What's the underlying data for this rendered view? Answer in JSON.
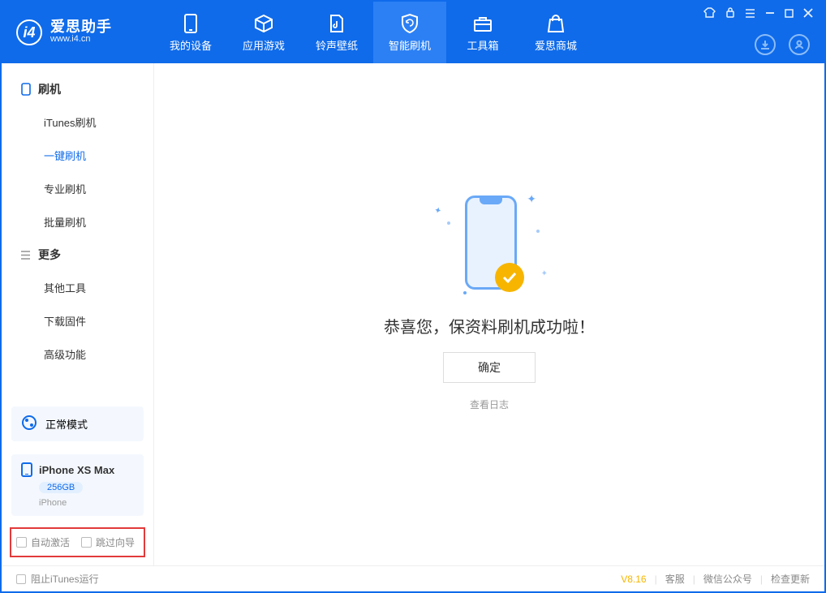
{
  "app": {
    "name": "爱思助手",
    "domain": "www.i4.cn"
  },
  "nav": {
    "tabs": [
      {
        "label": "我的设备"
      },
      {
        "label": "应用游戏"
      },
      {
        "label": "铃声壁纸"
      },
      {
        "label": "智能刷机"
      },
      {
        "label": "工具箱"
      },
      {
        "label": "爱思商城"
      }
    ],
    "active_index": 3
  },
  "sidebar": {
    "groups": [
      {
        "title": "刷机",
        "items": [
          "iTunes刷机",
          "一键刷机",
          "专业刷机",
          "批量刷机"
        ],
        "active_index": 1
      },
      {
        "title": "更多",
        "items": [
          "其他工具",
          "下载固件",
          "高级功能"
        ]
      }
    ],
    "mode_label": "正常模式",
    "device": {
      "name": "iPhone XS Max",
      "capacity": "256GB",
      "subtype": "iPhone"
    },
    "checks": {
      "auto_activate": "自动激活",
      "skip_guide": "跳过向导"
    }
  },
  "main": {
    "success_text": "恭喜您，保资料刷机成功啦！",
    "ok_label": "确定",
    "view_log": "查看日志"
  },
  "footer": {
    "block_itunes": "阻止iTunes运行",
    "version": "V8.16",
    "links": [
      "客服",
      "微信公众号",
      "检查更新"
    ]
  }
}
